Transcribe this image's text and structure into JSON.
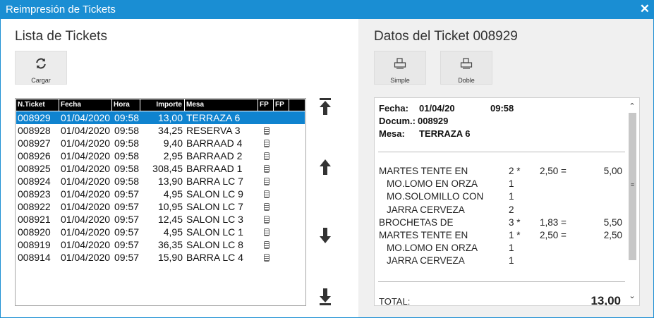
{
  "window": {
    "title": "Reimpresión de Tickets",
    "close_glyph": "✕"
  },
  "left": {
    "title": "Lista de Tickets",
    "load_button": {
      "label": "Cargar",
      "icon": "refresh-icon"
    },
    "columns": [
      "N.Ticket",
      "Fecha",
      "Hora",
      "Importe",
      "Mesa",
      "FP",
      "FP"
    ],
    "rows": [
      {
        "ticket": "008929",
        "date": "01/04/2020",
        "time": "09:58",
        "amount": "13,00",
        "table": "TERRAZA 6"
      },
      {
        "ticket": "008928",
        "date": "01/04/2020",
        "time": "09:58",
        "amount": "34,25",
        "table": "RESERVA 3"
      },
      {
        "ticket": "008927",
        "date": "01/04/2020",
        "time": "09:58",
        "amount": "9,40",
        "table": "BARRAAD 4"
      },
      {
        "ticket": "008926",
        "date": "01/04/2020",
        "time": "09:58",
        "amount": "2,95",
        "table": "BARRAAD 2"
      },
      {
        "ticket": "008925",
        "date": "01/04/2020",
        "time": "09:58",
        "amount": "308,45",
        "table": "BARRAAD 1"
      },
      {
        "ticket": "008924",
        "date": "01/04/2020",
        "time": "09:58",
        "amount": "13,90",
        "table": "BARRA LC 7"
      },
      {
        "ticket": "008923",
        "date": "01/04/2020",
        "time": "09:57",
        "amount": "4,95",
        "table": "SALON LC 9"
      },
      {
        "ticket": "008922",
        "date": "01/04/2020",
        "time": "09:57",
        "amount": "10,95",
        "table": "SALON LC 7"
      },
      {
        "ticket": "008921",
        "date": "01/04/2020",
        "time": "09:57",
        "amount": "12,45",
        "table": "SALON LC 3"
      },
      {
        "ticket": "008920",
        "date": "01/04/2020",
        "time": "09:57",
        "amount": "4,95",
        "table": "SALON LC 1"
      },
      {
        "ticket": "008919",
        "date": "01/04/2020",
        "time": "09:57",
        "amount": "36,35",
        "table": "SALON LC 8"
      },
      {
        "ticket": "008914",
        "date": "01/04/2020",
        "time": "09:57",
        "amount": "15,90",
        "table": "BARRA LC 4"
      }
    ],
    "selected_index": 0,
    "nav_icons": [
      "first-icon",
      "up-icon",
      "down-icon",
      "last-icon"
    ]
  },
  "right": {
    "title": "Datos del Ticket 008929",
    "simple_button": {
      "label": "Simple",
      "icon": "printer-icon"
    },
    "double_button": {
      "label": "Doble",
      "icon": "printer-icon"
    },
    "ticket": {
      "fecha_label": "Fecha:",
      "fecha_value": "01/04/20",
      "hora_value": "09:58",
      "docum_label": "Docum.:",
      "docum_value": "008929",
      "mesa_label": "Mesa:",
      "mesa_value": "TERRAZA 6",
      "lines": [
        {
          "desc": "MARTES TENTE EN",
          "qty": "2 *",
          "price": "2,50 =",
          "total": "5,00",
          "sub": false
        },
        {
          "desc": "MO.LOMO EN ORZA",
          "qty": "1",
          "price": "",
          "total": "",
          "sub": true
        },
        {
          "desc": "MO.SOLOMILLO CON",
          "qty": "1",
          "price": "",
          "total": "",
          "sub": true
        },
        {
          "desc": "JARRA CERVEZA",
          "qty": "2",
          "price": "",
          "total": "",
          "sub": true
        },
        {
          "desc": "BROCHETAS DE",
          "qty": "3 *",
          "price": "1,83 =",
          "total": "5,50",
          "sub": false
        },
        {
          "desc": "MARTES TENTE EN",
          "qty": "1 *",
          "price": "2,50 =",
          "total": "2,50",
          "sub": false
        },
        {
          "desc": "MO.LOMO EN ORZA",
          "qty": "1",
          "price": "",
          "total": "",
          "sub": true
        },
        {
          "desc": "JARRA CERVEZA",
          "qty": "1",
          "price": "",
          "total": "",
          "sub": true
        }
      ],
      "total_label": "TOTAL:",
      "total_value": "13,00"
    }
  }
}
